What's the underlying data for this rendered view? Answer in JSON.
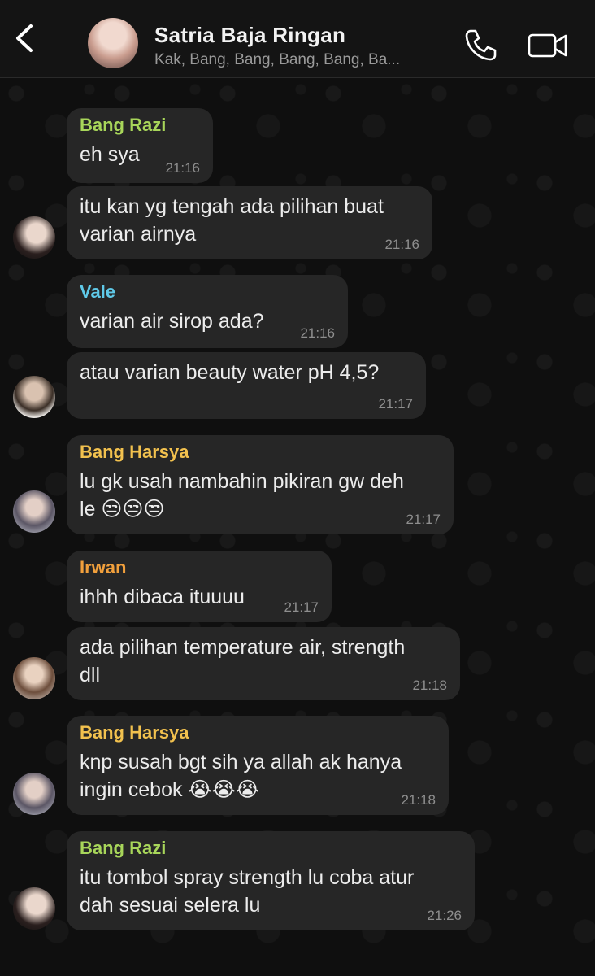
{
  "header": {
    "title": "Satria Baja Ringan",
    "subtitle": "Kak, Bang, Bang, Bang, Bang, Ba..."
  },
  "colors": {
    "razi": "#a8d65a",
    "vale": "#5fc9e8",
    "harsya": "#f2c14e",
    "irwan": "#f2a03c"
  },
  "messages": [
    {
      "sender": "Bang Razi",
      "text": "eh sya",
      "time": "21:16"
    },
    {
      "sender": "",
      "text": "itu kan yg tengah ada pilihan buat\nvarian airnya",
      "time": "21:16"
    },
    {
      "sender": "Vale",
      "text": "varian air sirop ada?",
      "time": "21:16"
    },
    {
      "sender": "",
      "text": "atau varian beauty water pH 4,5?",
      "time": "21:17"
    },
    {
      "sender": "Bang Harsya",
      "text": "lu gk usah nambahin pikiran gw deh\nle 😒😒😒",
      "time": "21:17"
    },
    {
      "sender": "Irwan",
      "text": "ihhh dibaca ituuuu",
      "time": "21:17"
    },
    {
      "sender": "",
      "text": "ada pilihan temperature air, strength\ndll",
      "time": "21:18"
    },
    {
      "sender": "Bang Harsya",
      "text": "knp susah bgt sih ya allah ak hanya\ningin cebok 😭😭😭",
      "time": "21:18"
    },
    {
      "sender": "Bang Razi",
      "text": "itu tombol spray strength lu coba atur\ndah sesuai selera lu",
      "time": "21:26"
    }
  ]
}
